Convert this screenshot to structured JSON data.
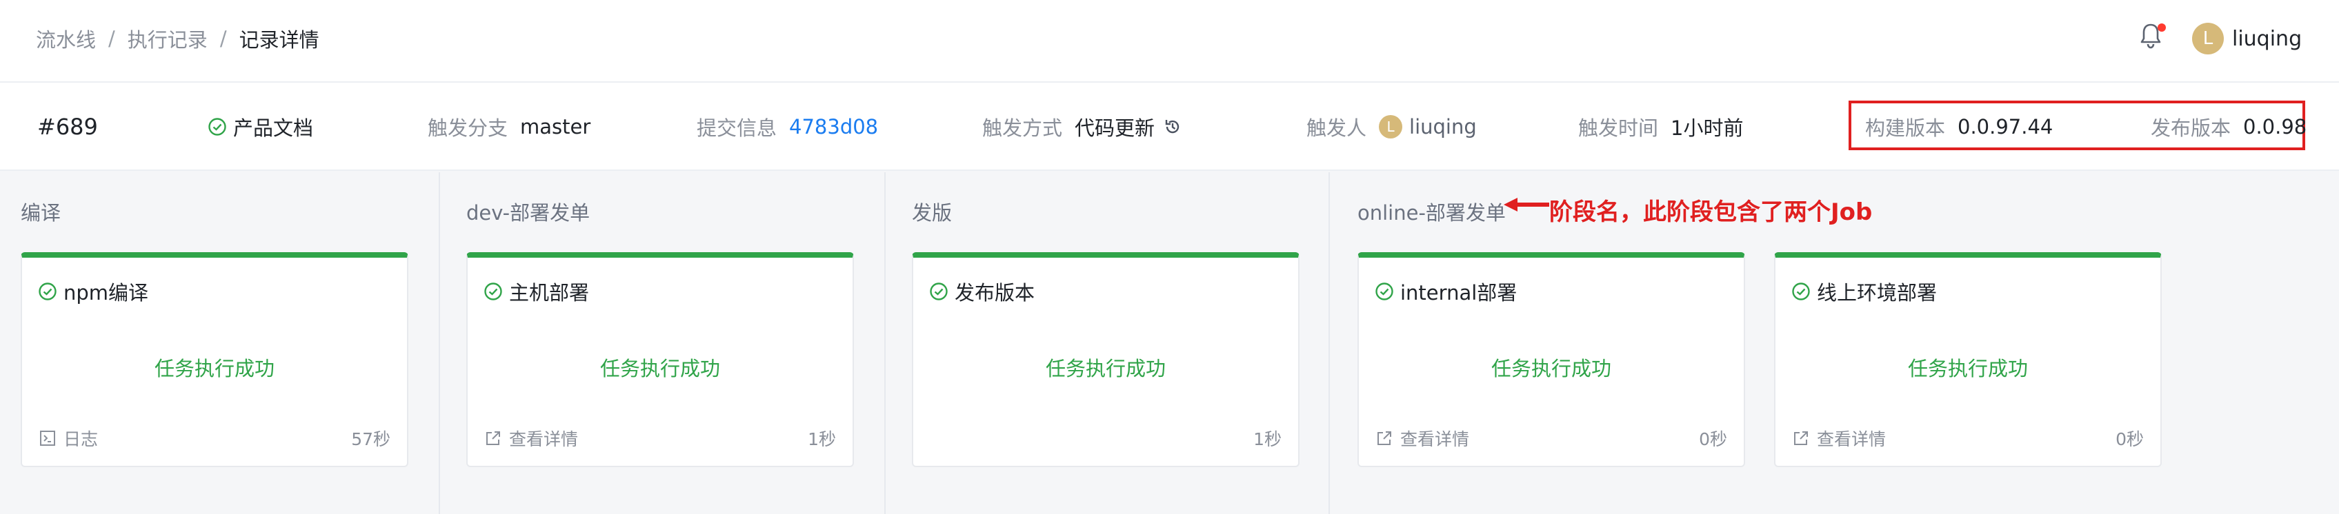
{
  "breadcrumb": {
    "items": [
      "流水线",
      "执行记录"
    ],
    "current": "记录详情",
    "separator": "/"
  },
  "header": {
    "user": {
      "avatar_letter": "L",
      "name": "liuqing"
    },
    "notification_icon": "bell-icon",
    "has_unread": true
  },
  "info": {
    "run_number": "#689",
    "pipeline_name": "产品文档",
    "branch_label": "触发分支",
    "branch_value": "master",
    "commit_label": "提交信息",
    "commit_value": "4783d08",
    "trigger_mode_label": "触发方式",
    "trigger_mode_value": "代码更新",
    "trigger_user_label": "触发人",
    "trigger_user_avatar": "L",
    "trigger_user_value": "liuqing",
    "trigger_time_label": "触发时间",
    "trigger_time_value": "1小时前",
    "build_version_label": "构建版本",
    "build_version_value": "0.0.97.44",
    "release_version_label": "发布版本",
    "release_version_value": "0.0.98"
  },
  "stages": [
    {
      "name": "编译",
      "jobs": [
        {
          "name": "npm编译",
          "status": "任务执行成功",
          "link_label": "日志",
          "link_icon": "terminal-icon",
          "duration": "57秒"
        }
      ]
    },
    {
      "name": "dev-部署发单",
      "jobs": [
        {
          "name": "主机部署",
          "status": "任务执行成功",
          "link_label": "查看详情",
          "link_icon": "external-link-icon",
          "duration": "1秒"
        }
      ]
    },
    {
      "name": "发版",
      "jobs": [
        {
          "name": "发布版本",
          "status": "任务执行成功",
          "link_label": "",
          "link_icon": "",
          "duration": "1秒"
        }
      ]
    },
    {
      "name": "online-部署发单",
      "jobs": [
        {
          "name": "internal部署",
          "status": "任务执行成功",
          "link_label": "查看详情",
          "link_icon": "external-link-icon",
          "duration": "0秒"
        },
        {
          "name": "线上环境部署",
          "status": "任务执行成功",
          "link_label": "查看详情",
          "link_icon": "external-link-icon",
          "duration": "0秒"
        }
      ]
    }
  ],
  "annotation": {
    "text": "阶段名，此阶段包含了两个Job"
  },
  "colors": {
    "success": "#30a449",
    "link": "#1a7cf0",
    "annotation": "#e02020",
    "avatar": "#d6b979"
  }
}
